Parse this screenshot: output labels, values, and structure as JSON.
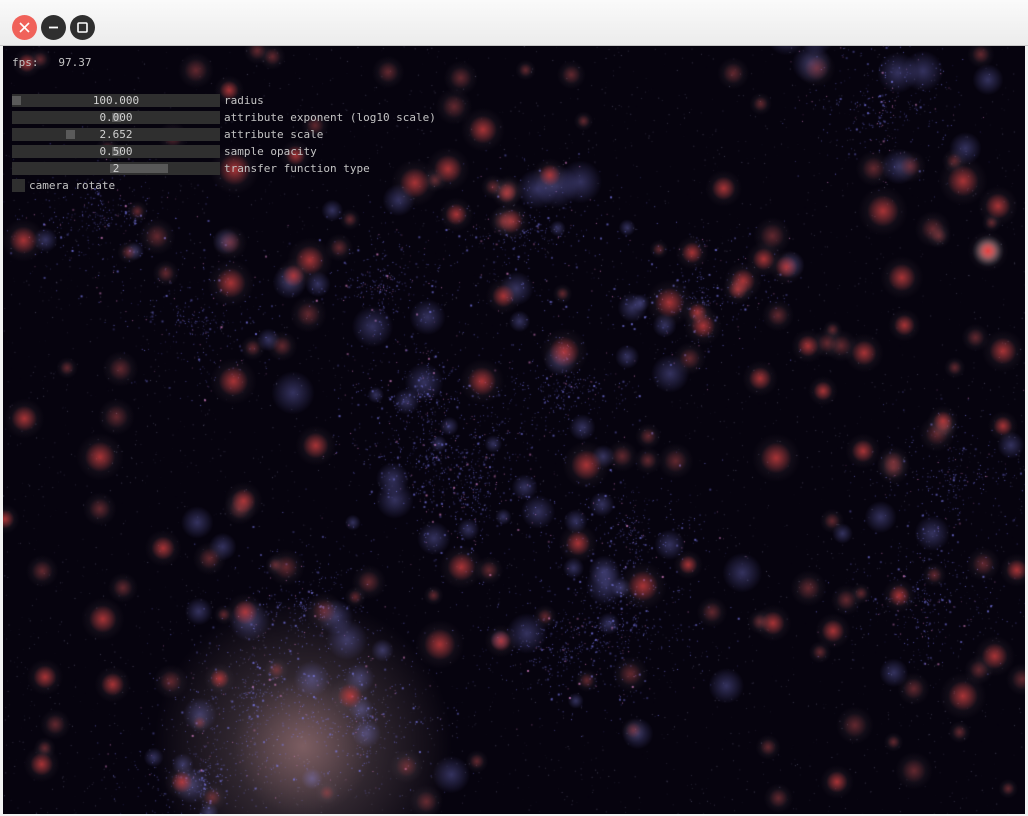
{
  "window": {
    "controls": {
      "close": "close-icon",
      "minimize": "minimize-icon",
      "maximize": "maximize-icon"
    }
  },
  "hud": {
    "fps_label": "fps:",
    "fps_value": "97.37",
    "controls": [
      {
        "label": "radius",
        "value": "100.000",
        "level": 0.0
      },
      {
        "label": "attribute exponent (log10 scale)",
        "value": "0.000",
        "level": 0.5
      },
      {
        "label": "attribute scale",
        "value": "2.652",
        "level": 0.27
      },
      {
        "label": "sample opacity",
        "value": "0.500",
        "level": 0.5
      },
      {
        "label": "transfer function type",
        "value": "2",
        "level": 0.75,
        "style": "fill"
      }
    ],
    "camera_rotate": {
      "label": "camera rotate",
      "checked": false
    }
  },
  "colors": {
    "background": "#06030e",
    "particle_blue": "#7d7cf0",
    "particle_pink": "#e58ad3",
    "halo_red": "#d23a3a"
  }
}
